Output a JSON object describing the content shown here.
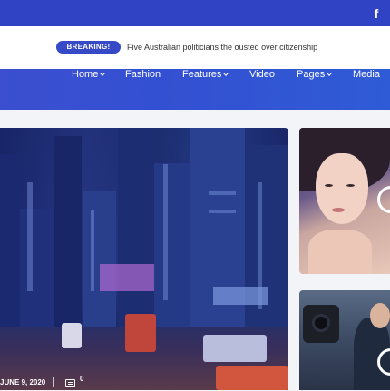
{
  "header": {
    "social_icon": "facebook-icon",
    "social_glyph": "f"
  },
  "breaking": {
    "badge": "BREAKING!",
    "headline": "Five Australian politicians the ousted over citizenship"
  },
  "nav": {
    "items": [
      {
        "label": "Home",
        "has_dropdown": true
      },
      {
        "label": "Fashion",
        "has_dropdown": false
      },
      {
        "label": "Features",
        "has_dropdown": true
      },
      {
        "label": "Video",
        "has_dropdown": false
      },
      {
        "label": "Pages",
        "has_dropdown": true
      },
      {
        "label": "Media",
        "has_dropdown": false
      }
    ]
  },
  "featured": {
    "date": "JUNE 9, 2020",
    "comments": "0",
    "comment_icon": "comment-icon"
  },
  "colors": {
    "topbar": "#2f43c4",
    "badge": "#3649c7",
    "nav_start": "#3b4fd0",
    "nav_end": "#2f5bd6"
  }
}
